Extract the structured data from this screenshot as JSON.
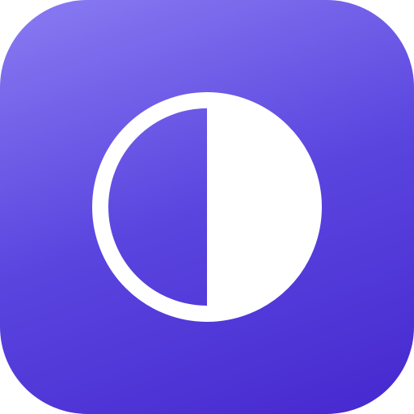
{
  "app_icon": {
    "icon": "contrast-icon",
    "colors": {
      "gradient_start": "#8a7cf2",
      "gradient_mid": "#5a45df",
      "gradient_end": "#4628cf",
      "glyph": "#ffffff"
    }
  }
}
